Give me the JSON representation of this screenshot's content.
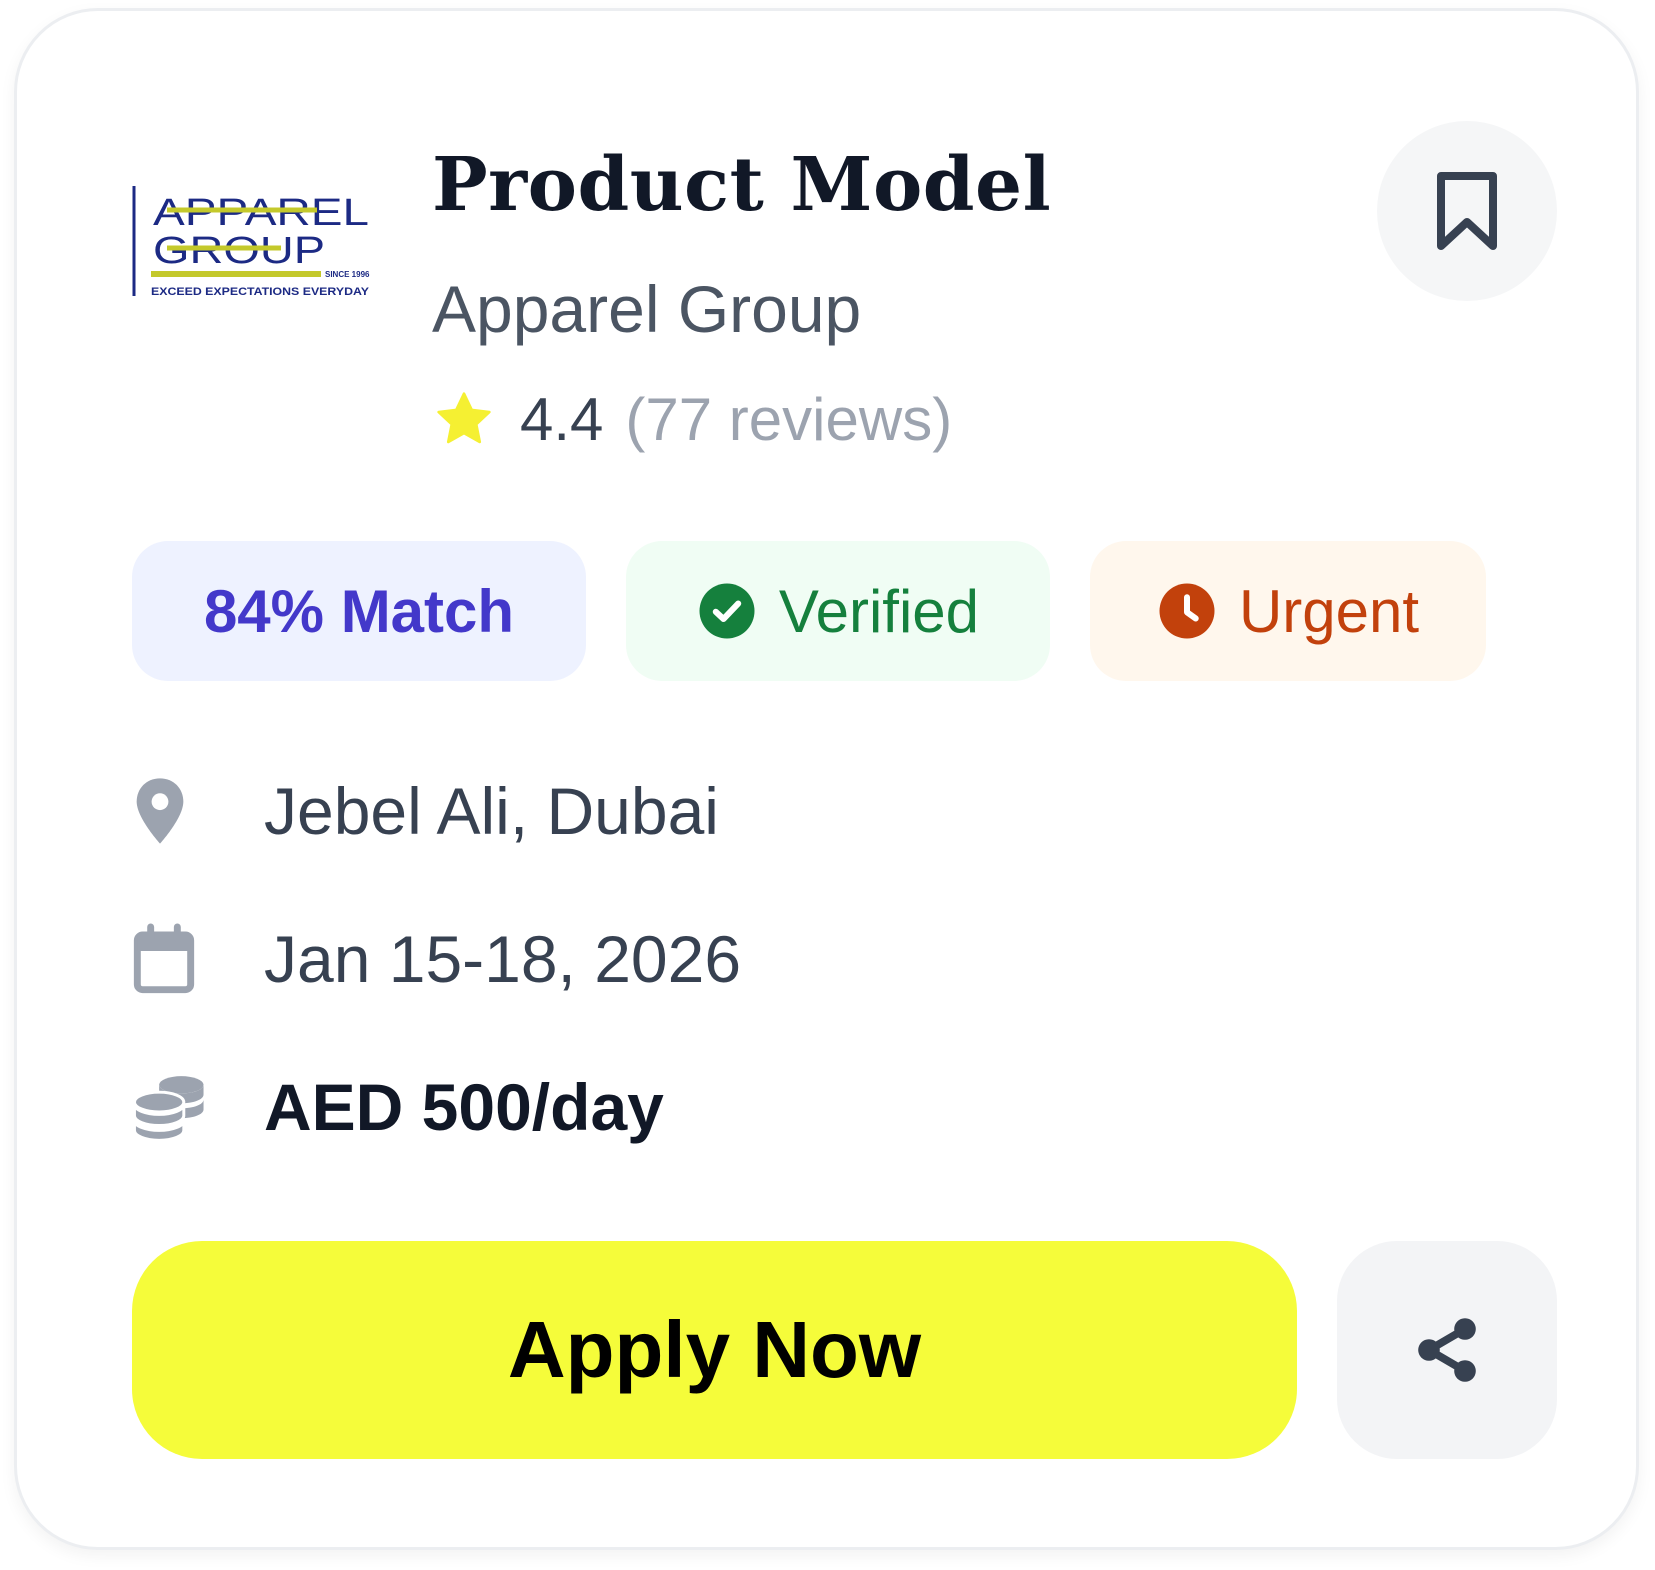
{
  "logo": {
    "brand_line1": "APPAREL",
    "brand_line2": "GROUP",
    "since": "SINCE 1996",
    "tagline": "EXCEED EXPECTATIONS EVERYDAY"
  },
  "job": {
    "title": "Product Model",
    "company": "Apparel Group",
    "rating": "4.4",
    "reviews": "(77 reviews)"
  },
  "badges": {
    "match": "84% Match",
    "verified": "Verified",
    "urgent": "Urgent"
  },
  "details": {
    "location": "Jebel Ali, Dubai",
    "dates": "Jan 15-18, 2026",
    "pay": "AED 500/day"
  },
  "actions": {
    "apply_label": "Apply Now"
  },
  "icons": {
    "bookmark": "bookmark-icon",
    "star": "star-icon",
    "verified": "check-circle-icon",
    "urgent": "clock-icon",
    "location": "map-pin-icon",
    "date": "calendar-icon",
    "pay": "coins-icon",
    "share": "share-icon"
  },
  "colors": {
    "apply_button": "#f5fc3a",
    "match_text": "#4338ca",
    "match_bg": "#eef2ff",
    "verified_text": "#15803d",
    "verified_bg": "#f0fdf4",
    "urgent_text": "#c2410c",
    "urgent_bg": "#fff7ed",
    "star": "#f5f032",
    "logo_navy": "#1c2a84",
    "logo_accent": "#c4c92b"
  }
}
